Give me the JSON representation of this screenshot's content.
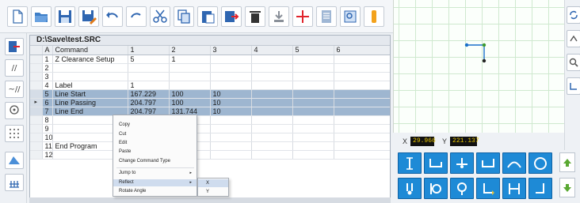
{
  "toolbar": {
    "icons": [
      "new-file-icon",
      "open-folder-icon",
      "save-icon",
      "save-as-icon",
      "undo-icon",
      "redo-icon",
      "cut-icon",
      "copy-icon",
      "paste-icon",
      "insert-row-icon",
      "delete-icon",
      "clear-all-icon",
      "crosshair-icon",
      "document-icon",
      "zoom-icon",
      "warning-icon"
    ]
  },
  "editor": {
    "file_path": "D:\\Save\\test.SRC",
    "columns": [
      "A",
      "Command",
      "1",
      "2",
      "3",
      "4",
      "5",
      "6"
    ],
    "rows": [
      {
        "n": "1",
        "command": "Z Clearance Setup",
        "c1": "5",
        "c2": "1",
        "c3": ""
      },
      {
        "n": "2",
        "command": "",
        "c1": "",
        "c2": "",
        "c3": ""
      },
      {
        "n": "3",
        "command": "",
        "c1": "",
        "c2": "",
        "c3": ""
      },
      {
        "n": "4",
        "command": "Label",
        "c1": "1",
        "c2": "",
        "c3": ""
      },
      {
        "n": "5",
        "command": "Line Start",
        "c1": "167.229",
        "c2": "100",
        "c3": "10"
      },
      {
        "n": "6",
        "command": "Line Passing",
        "c1": "204.797",
        "c2": "100",
        "c3": "10"
      },
      {
        "n": "7",
        "command": "Line End",
        "c1": "204.797",
        "c2": "131.744",
        "c3": "10"
      },
      {
        "n": "8",
        "command": "",
        "c1": "",
        "c2": "",
        "c3": ""
      },
      {
        "n": "9",
        "command": "",
        "c1": "",
        "c2": "",
        "c3": ""
      },
      {
        "n": "10",
        "command": "",
        "c1": "",
        "c2": "",
        "c3": ""
      },
      {
        "n": "11",
        "command": "End Program",
        "c1": "",
        "c2": "",
        "c3": ""
      },
      {
        "n": "12",
        "command": "",
        "c1": "",
        "c2": "",
        "c3": ""
      }
    ],
    "selected_rows": [
      "5",
      "6",
      "7"
    ]
  },
  "context_menu": {
    "items": [
      "Copy",
      "Cut",
      "Edit",
      "Paste",
      "Change Command Type",
      "Jump to",
      "Reflect",
      "Rotate Angle"
    ],
    "submenu": [
      "X",
      "Y"
    ]
  },
  "preview": {
    "x_label": "X",
    "x_value": "29.966",
    "y_label": "Y",
    "y_value": "221.137"
  },
  "colors": {
    "accent": "#1e8ad6",
    "selection": "#9eb6d0",
    "coord_text": "#e5c300",
    "grid_line": "#cfe9cf"
  }
}
